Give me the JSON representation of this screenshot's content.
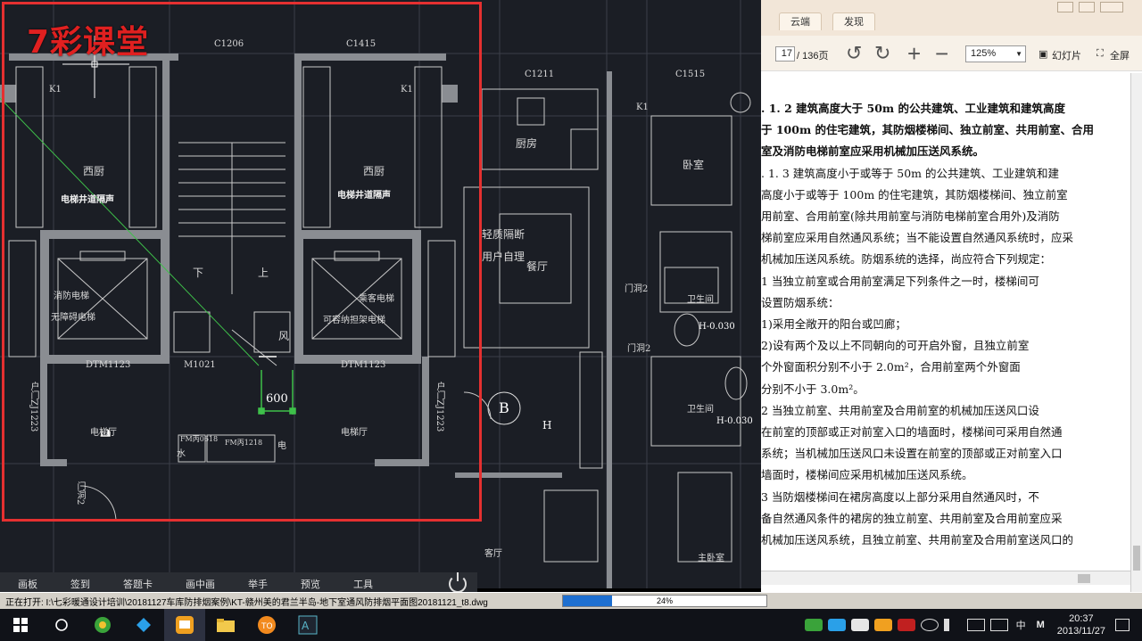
{
  "brand": "7彩课堂",
  "cad": {
    "labels": {
      "c1206": "C1206",
      "c1415": "C1415",
      "c1211": "C1211",
      "c1515": "C1515",
      "k1_left": "K1",
      "k1_mid": "K1",
      "k1_right": "K1",
      "xichu_left": "西厨",
      "xichu_right": "西厨",
      "elev_shaft_left": "电梯井道隔声",
      "elev_shaft_right": "电梯井道隔声",
      "down": "下",
      "up": "上",
      "fire_elevator": "消防电梯",
      "barrier_free_elevator": "无障碍电梯",
      "passenger_elevator": "乘客电梯",
      "stretcher_elevator": "可容纳担架电梯",
      "wind": "风",
      "dtm_left": "DTM1123",
      "m1021": "M1021",
      "dtm_right": "DTM1123",
      "dimension": "600",
      "elevator_hall_left": "电梯厅",
      "elevator_hall_right": "电梯厅",
      "fm_a": "FM丙0618",
      "fm_b": "FM丙1218",
      "water": "水",
      "elec": "电",
      "door_left": "户门ZJ1223",
      "door_right": "户门ZJ1223",
      "door_low": "门洞2",
      "kitchen": "厨房",
      "bedroom": "卧室",
      "dining": "餐厅",
      "partition": "轻质隔断",
      "user_choice": "用户自理",
      "door_hole_1": "门洞2",
      "door_hole_2": "门洞2",
      "bathroom_1": "卫生间",
      "bathroom_2": "卫生间",
      "level_1": "H-0.030",
      "level_2": "H-0.030",
      "axis_b": "B",
      "h": "H",
      "bedroom_low": "卧室",
      "living": "客厅",
      "master_bedroom": "主卧室"
    }
  },
  "class_toolbar": {
    "items": [
      "画板",
      "签到",
      "答题卡",
      "画中画",
      "举手",
      "预览",
      "工具"
    ]
  },
  "status_bar": {
    "text": "正在打开: I:\\七彩暖通设计培训\\20181127车库防排烟案例\\KT-赣州美的君兰半岛-地下室通风防排烟平面图20181121_t8.dwg",
    "progress": 0.24,
    "progress_label": "24%"
  },
  "pdf": {
    "tabs": [
      "云端",
      "发现"
    ],
    "current_page": "17",
    "total_pages": "/ 136页",
    "zoom": "125%",
    "slideshow_label": "幻灯片",
    "fullscreen_label": "全屏",
    "lines": [
      {
        "t": ". 1. 2   建筑高度大于 50m 的公共建筑、工业建筑和建筑高度",
        "b": true
      },
      {
        "t": "于 100m 的住宅建筑，其防烟楼梯间、独立前室、共用前室、合用",
        "b": true
      },
      {
        "t": "室及消防电梯前室应采用机械加压送风系统。",
        "b": true
      },
      {
        "t": ". 1. 3   建筑高度小于或等于 50m 的公共建筑、工业建筑和建",
        "b": false
      },
      {
        "t": "高度小于或等于 100m 的住宅建筑，其防烟楼梯间、独立前室",
        "b": false
      },
      {
        "t": "用前室、合用前室(除共用前室与消防电梯前室合用外)及消防",
        "b": false
      },
      {
        "t": "梯前室应采用自然通风系统；当不能设置自然通风系统时，应采",
        "b": false
      },
      {
        "t": "机械加压送风系统。防烟系统的选择，尚应符合下列规定：",
        "b": false
      },
      {
        "t": "   1   当独立前室或合用前室满足下列条件之一时，楼梯间可",
        "b": false
      },
      {
        "t": "设置防烟系统：",
        "b": false
      },
      {
        "t": "      1)采用全敞开的阳台或凹廊；",
        "b": false
      },
      {
        "t": "      2)设有两个及以上不同朝向的可开启外窗，且独立前室",
        "b": false
      },
      {
        "t": "        个外窗面积分别不小于 2.0m²，合用前室两个外窗面",
        "b": false
      },
      {
        "t": "        分别不小于 3.0m²。",
        "b": false
      },
      {
        "t": "   2   当独立前室、共用前室及合用前室的机械加压送风口设",
        "b": false
      },
      {
        "t": "在前室的顶部或正对前室入口的墙面时，楼梯间可采用自然通",
        "b": false
      },
      {
        "t": "系统；当机械加压送风口未设置在前室的顶部或正对前室入口",
        "b": false
      },
      {
        "t": "墙面时，楼梯间应采用机械加压送风系统。",
        "b": false
      },
      {
        "t": "   3   当防烟楼梯间在裙房高度以上部分采用自然通风时，不",
        "b": false
      },
      {
        "t": "备自然通风条件的裙房的独立前室、共用前室及合用前室应采",
        "b": false
      },
      {
        "t": "机械加压送风系统，且独立前室、共用前室及合用前室送风口的",
        "b": false
      }
    ]
  },
  "taskbar": {
    "time": "20:37",
    "date": "2013/11/27",
    "ime": "中",
    "ime_mode": "M",
    "icons": [
      "start-icon",
      "search-icon",
      "browser-icon",
      "app-blue-icon",
      "classroom-icon",
      "folder-icon",
      "tour-icon",
      "text-editor-icon"
    ]
  },
  "colors": {
    "red_frame": "#e53030",
    "cad_bg": "#1b1e25",
    "wall": "#8a8d92"
  }
}
